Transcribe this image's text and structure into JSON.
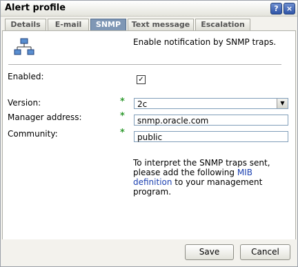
{
  "window": {
    "title": "Alert profile",
    "help_glyph": "?",
    "close_glyph": "×"
  },
  "tabs": [
    {
      "label": "Details"
    },
    {
      "label": "E-mail"
    },
    {
      "label": "SNMP"
    },
    {
      "label": "Text message"
    },
    {
      "label": "Escalation"
    }
  ],
  "active_tab": "SNMP",
  "intro_text": "Enable notification by SNMP traps.",
  "form": {
    "enabled_label": "Enabled:",
    "enabled_checked": true,
    "version_label": "Version:",
    "version_value": "2c",
    "manager_label": "Manager address:",
    "manager_value": "snmp.oracle.com",
    "community_label": "Community:",
    "community_value": "public",
    "required_marker": "*"
  },
  "info": {
    "text_before": "To interpret the SNMP traps sent, please add the following ",
    "link_text": "MIB definition",
    "text_after": " to your management program."
  },
  "buttons": {
    "save": "Save",
    "cancel": "Cancel"
  },
  "colors": {
    "accent_tab": "#7f97b5",
    "required": "#2f9a2f",
    "link": "#1a3fb0"
  },
  "icons": {
    "network": "network-icon",
    "help": "help-icon",
    "close": "close-icon"
  }
}
